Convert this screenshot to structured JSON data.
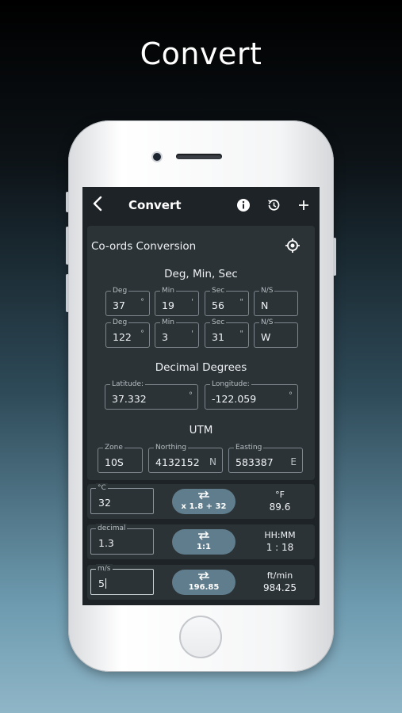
{
  "headline": "Convert",
  "appbar": {
    "back_icon": "chevron-left-icon",
    "title": "Convert",
    "icons": [
      "info-icon",
      "history-icon",
      "plus-icon"
    ]
  },
  "coords": {
    "title": "Co-ords Conversion",
    "locate_icon": "crosshair-icon",
    "dms": {
      "heading": "Deg, Min, Sec",
      "rows": [
        {
          "deg_label": "Deg",
          "deg": "37",
          "deg_unit": "°",
          "min_label": "Min",
          "min": "19",
          "min_unit": "'",
          "sec_label": "Sec",
          "sec": "56",
          "sec_unit": "\"",
          "dir_label": "N/S",
          "dir": "N"
        },
        {
          "deg_label": "Deg",
          "deg": "122",
          "deg_unit": "°",
          "min_label": "Min",
          "min": "3",
          "min_unit": "'",
          "sec_label": "Sec",
          "sec": "31",
          "sec_unit": "\"",
          "dir_label": "N/S",
          "dir": "W"
        }
      ]
    },
    "decimal": {
      "heading": "Decimal Degrees",
      "lat_label": "Latitude:",
      "lat": "37.332",
      "lat_unit": "°",
      "lon_label": "Longitude:",
      "lon": "-122.059",
      "lon_unit": "°"
    },
    "utm": {
      "heading": "UTM",
      "zone_label": "Zone",
      "zone": "10S",
      "northing_label": "Northing",
      "northing": "4132152",
      "northing_unit": "N",
      "easting_label": "Easting",
      "easting": "583387",
      "easting_unit": "E"
    }
  },
  "conversions": [
    {
      "input_label": "°C",
      "input": "32",
      "formula": "x 1.8 + 32",
      "output_unit": "°F",
      "output": "89.6"
    },
    {
      "input_label": "decimal",
      "input": "1.3",
      "formula": "1:1",
      "output_unit": "HH:MM",
      "output": "1 : 18"
    },
    {
      "input_label": "m/s",
      "input": "5",
      "formula": "196.85",
      "output_unit": "ft/min",
      "output": "984.25"
    }
  ],
  "colors": {
    "screen_bg": "#1d2327",
    "card_bg": "#2b3337",
    "pill": "#5f7d8c"
  }
}
